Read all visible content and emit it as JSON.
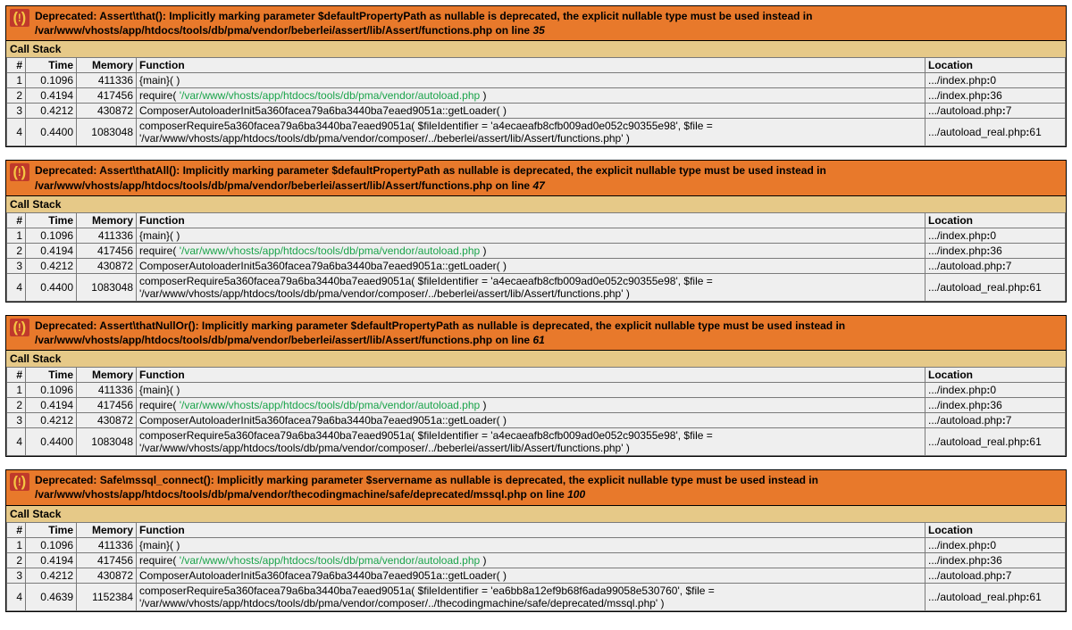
{
  "headers": {
    "n": "#",
    "time": "Time",
    "memory": "Memory",
    "function": "Function",
    "location": "Location"
  },
  "callstack_label": "Call Stack",
  "blocks": [
    {
      "message": {
        "prefix": "Deprecated: Assert\\that(): Implicitly marking parameter $defaultPropertyPath as nullable is deprecated, the explicit nullable type must be used instead in ",
        "file": "/var/www/vhosts/app/htdocs/tools/db/pma/vendor/beberlei/assert/lib/Assert/functions.php",
        "on_line": " on line ",
        "line": "35"
      },
      "rows": [
        {
          "n": "1",
          "time": "0.1096",
          "mem": "411336",
          "fn_pre": "{main}( )",
          "fn_link": "",
          "fn_post": "",
          "loc": ".../index.php",
          "loc_line": "0"
        },
        {
          "n": "2",
          "time": "0.4194",
          "mem": "417456",
          "fn_pre": "require( ",
          "fn_link": "'/var/www/vhosts/app/htdocs/tools/db/pma/vendor/autoload.php",
          "fn_post": " )",
          "loc": ".../index.php",
          "loc_line": "36"
        },
        {
          "n": "3",
          "time": "0.4212",
          "mem": "430872",
          "fn_pre": "ComposerAutoloaderInit5a360facea79a6ba3440ba7eaed9051a::getLoader( )",
          "fn_link": "",
          "fn_post": "",
          "loc": ".../autoload.php",
          "loc_line": "7"
        },
        {
          "n": "4",
          "time": "0.4400",
          "mem": "1083048",
          "fn_pre": "composerRequire5a360facea79a6ba3440ba7eaed9051a( $fileIdentifier = 'a4ecaeafb8cfb009ad0e052c90355e98', $file = '/var/www/vhosts/app/htdocs/tools/db/pma/vendor/composer/../beberlei/assert/lib/Assert/functions.php' )",
          "fn_link": "",
          "fn_post": "",
          "loc": ".../autoload_real.php",
          "loc_line": "61"
        }
      ]
    },
    {
      "message": {
        "prefix": "Deprecated: Assert\\thatAll(): Implicitly marking parameter $defaultPropertyPath as nullable is deprecated, the explicit nullable type must be used instead in ",
        "file": "/var/www/vhosts/app/htdocs/tools/db/pma/vendor/beberlei/assert/lib/Assert/functions.php",
        "on_line": " on line ",
        "line": "47"
      },
      "rows": [
        {
          "n": "1",
          "time": "0.1096",
          "mem": "411336",
          "fn_pre": "{main}( )",
          "fn_link": "",
          "fn_post": "",
          "loc": ".../index.php",
          "loc_line": "0"
        },
        {
          "n": "2",
          "time": "0.4194",
          "mem": "417456",
          "fn_pre": "require( ",
          "fn_link": "'/var/www/vhosts/app/htdocs/tools/db/pma/vendor/autoload.php",
          "fn_post": " )",
          "loc": ".../index.php",
          "loc_line": "36"
        },
        {
          "n": "3",
          "time": "0.4212",
          "mem": "430872",
          "fn_pre": "ComposerAutoloaderInit5a360facea79a6ba3440ba7eaed9051a::getLoader( )",
          "fn_link": "",
          "fn_post": "",
          "loc": ".../autoload.php",
          "loc_line": "7"
        },
        {
          "n": "4",
          "time": "0.4400",
          "mem": "1083048",
          "fn_pre": "composerRequire5a360facea79a6ba3440ba7eaed9051a( $fileIdentifier = 'a4ecaeafb8cfb009ad0e052c90355e98', $file = '/var/www/vhosts/app/htdocs/tools/db/pma/vendor/composer/../beberlei/assert/lib/Assert/functions.php' )",
          "fn_link": "",
          "fn_post": "",
          "loc": ".../autoload_real.php",
          "loc_line": "61"
        }
      ]
    },
    {
      "message": {
        "prefix": "Deprecated: Assert\\thatNullOr(): Implicitly marking parameter $defaultPropertyPath as nullable is deprecated, the explicit nullable type must be used instead in ",
        "file": "/var/www/vhosts/app/htdocs/tools/db/pma/vendor/beberlei/assert/lib/Assert/functions.php",
        "on_line": " on line ",
        "line": "61"
      },
      "rows": [
        {
          "n": "1",
          "time": "0.1096",
          "mem": "411336",
          "fn_pre": "{main}( )",
          "fn_link": "",
          "fn_post": "",
          "loc": ".../index.php",
          "loc_line": "0"
        },
        {
          "n": "2",
          "time": "0.4194",
          "mem": "417456",
          "fn_pre": "require( ",
          "fn_link": "'/var/www/vhosts/app/htdocs/tools/db/pma/vendor/autoload.php",
          "fn_post": " )",
          "loc": ".../index.php",
          "loc_line": "36"
        },
        {
          "n": "3",
          "time": "0.4212",
          "mem": "430872",
          "fn_pre": "ComposerAutoloaderInit5a360facea79a6ba3440ba7eaed9051a::getLoader( )",
          "fn_link": "",
          "fn_post": "",
          "loc": ".../autoload.php",
          "loc_line": "7"
        },
        {
          "n": "4",
          "time": "0.4400",
          "mem": "1083048",
          "fn_pre": "composerRequire5a360facea79a6ba3440ba7eaed9051a( $fileIdentifier = 'a4ecaeafb8cfb009ad0e052c90355e98', $file = '/var/www/vhosts/app/htdocs/tools/db/pma/vendor/composer/../beberlei/assert/lib/Assert/functions.php' )",
          "fn_link": "",
          "fn_post": "",
          "loc": ".../autoload_real.php",
          "loc_line": "61"
        }
      ]
    },
    {
      "message": {
        "prefix": "Deprecated: Safe\\mssql_connect(): Implicitly marking parameter $servername as nullable is deprecated, the explicit nullable type must be used instead in ",
        "file": "/var/www/vhosts/app/htdocs/tools/db/pma/vendor/thecodingmachine/safe/deprecated/mssql.php",
        "on_line": " on line ",
        "line": "100"
      },
      "rows": [
        {
          "n": "1",
          "time": "0.1096",
          "mem": "411336",
          "fn_pre": "{main}( )",
          "fn_link": "",
          "fn_post": "",
          "loc": ".../index.php",
          "loc_line": "0"
        },
        {
          "n": "2",
          "time": "0.4194",
          "mem": "417456",
          "fn_pre": "require( ",
          "fn_link": "'/var/www/vhosts/app/htdocs/tools/db/pma/vendor/autoload.php",
          "fn_post": " )",
          "loc": ".../index.php",
          "loc_line": "36"
        },
        {
          "n": "3",
          "time": "0.4212",
          "mem": "430872",
          "fn_pre": "ComposerAutoloaderInit5a360facea79a6ba3440ba7eaed9051a::getLoader( )",
          "fn_link": "",
          "fn_post": "",
          "loc": ".../autoload.php",
          "loc_line": "7"
        },
        {
          "n": "4",
          "time": "0.4639",
          "mem": "1152384",
          "fn_pre": "composerRequire5a360facea79a6ba3440ba7eaed9051a( $fileIdentifier = 'ea6bb8a12ef9b68f6ada99058e530760', $file = '/var/www/vhosts/app/htdocs/tools/db/pma/vendor/composer/../thecodingmachine/safe/deprecated/mssql.php' )",
          "fn_link": "",
          "fn_post": "",
          "loc": ".../autoload_real.php",
          "loc_line": "61"
        }
      ]
    }
  ]
}
